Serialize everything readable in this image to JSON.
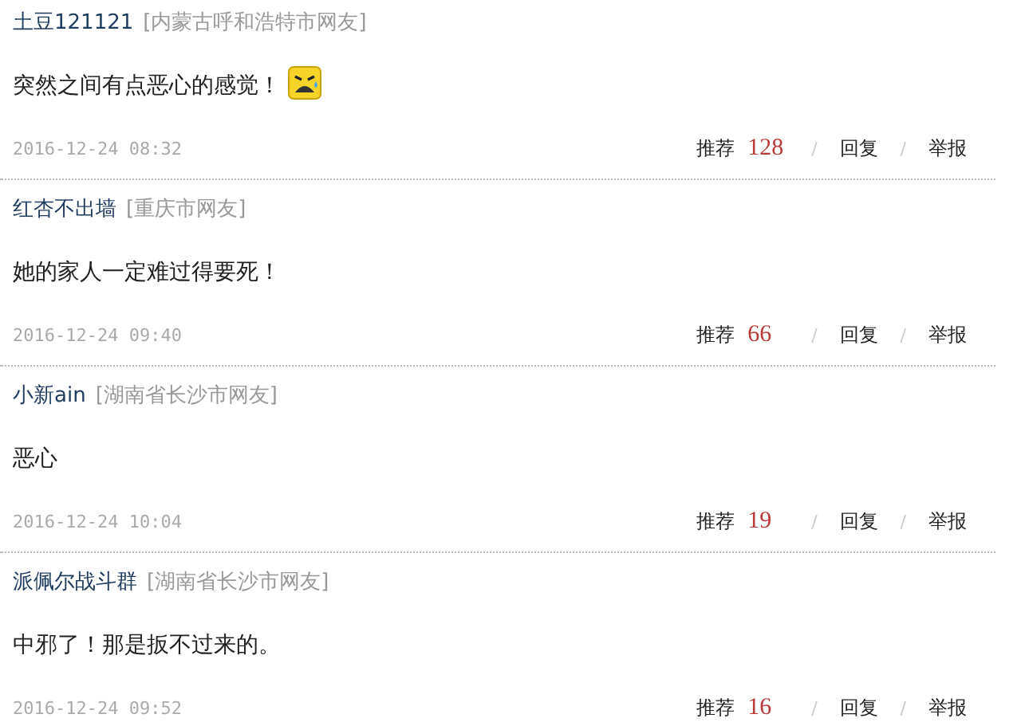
{
  "comments": [
    {
      "user": "土豆121121",
      "location": "[内蒙古呼和浩特市网友]",
      "text": "突然之间有点恶心的感觉！",
      "emoji": true,
      "time": "2016-12-24 08:32",
      "recommend": "推荐",
      "count": "128",
      "reply": "回复",
      "report": "举报"
    },
    {
      "user": "红杏不出墙",
      "location": "[重庆市网友]",
      "text": "她的家人一定难过得要死！",
      "time": "2016-12-24 09:40",
      "recommend": "推荐",
      "count": "66",
      "reply": "回复",
      "report": "举报"
    },
    {
      "user": "小新ain",
      "location": "[湖南省长沙市网友]",
      "text": "恶心",
      "time": "2016-12-24 10:04",
      "recommend": "推荐",
      "count": "19",
      "reply": "回复",
      "report": "举报"
    },
    {
      "user": "派佩尔战斗群",
      "location": "[湖南省长沙市网友]",
      "text": "中邪了！那是扳不过来的。",
      "time": "2016-12-24 09:52",
      "recommend": "推荐",
      "count": "16",
      "reply": "回复",
      "report": "举报"
    }
  ],
  "separator": "/"
}
